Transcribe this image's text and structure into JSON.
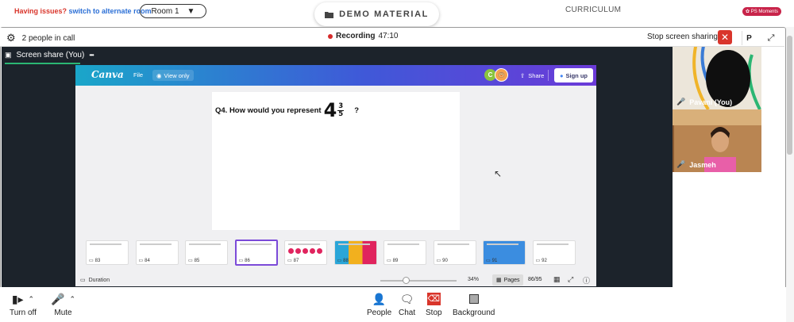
{
  "topbar": {
    "issues_label": "Having issues?",
    "alternate_room_link": "switch to alternate room",
    "room_select": "Room 1",
    "demo_material": "DEMO MATERIAL",
    "curriculum": "CURRICULUM",
    "ps_moments": "PS Moments"
  },
  "callbar": {
    "people_count": "2 people in call",
    "recording_label": "Recording",
    "recording_time": "47:10",
    "stop_sharing": "Stop screen sharing",
    "p_button": "P"
  },
  "screenshare": {
    "tab_label": "Screen share (You)",
    "more": "•••"
  },
  "canva": {
    "logo": "Canva",
    "file": "File",
    "view_only": "View only",
    "avatar_initial": "C",
    "share": "Share",
    "sign_up": "Sign up",
    "question": "Q4. How would you represent",
    "whole": "4",
    "numerator": "3",
    "denominator": "5",
    "question_mark": "?",
    "thumbnails": [
      {
        "num": "83",
        "selected": false
      },
      {
        "num": "84",
        "selected": false
      },
      {
        "num": "85",
        "selected": false
      },
      {
        "num": "86",
        "selected": true
      },
      {
        "num": "87",
        "selected": false
      },
      {
        "num": "88",
        "selected": false
      },
      {
        "num": "89",
        "selected": false
      },
      {
        "num": "90",
        "selected": false
      },
      {
        "num": "91",
        "selected": false
      },
      {
        "num": "92",
        "selected": false
      }
    ],
    "duration": "Duration",
    "zoom": "34%",
    "pages_label": "Pages",
    "page_count": "86/95"
  },
  "participants": [
    {
      "name": "Pavani (You)"
    },
    {
      "name": "Jasmeh"
    }
  ],
  "controls": {
    "camera": "Turn off",
    "mic": "Mute",
    "people": "People",
    "chat": "Chat",
    "stop": "Stop",
    "background": "Background"
  },
  "colors": {
    "record_red": "#d62b2b",
    "share_green": "#2bb673",
    "selected_thumb": "#7b4ad8",
    "stop_red": "#d9352b"
  }
}
